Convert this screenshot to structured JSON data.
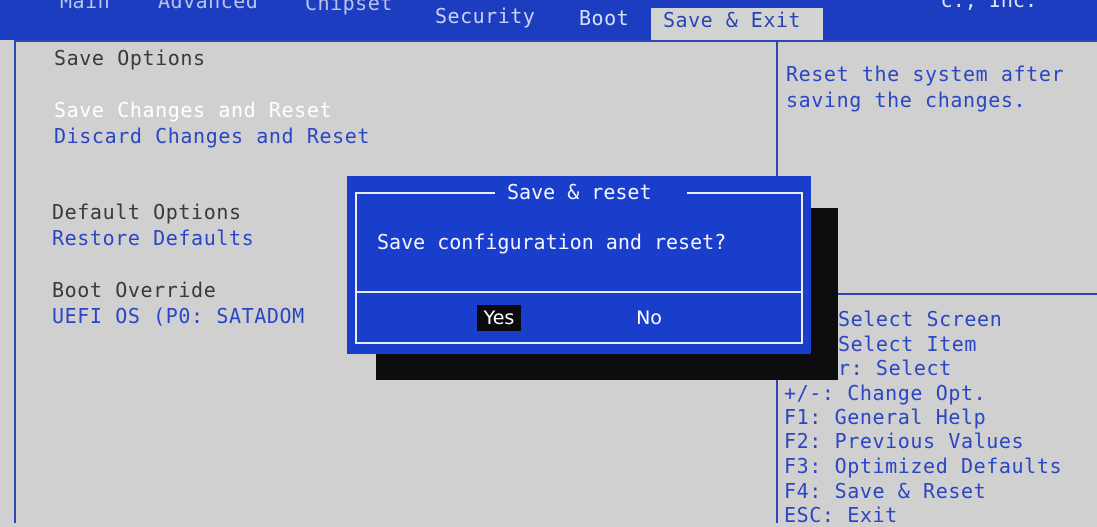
{
  "menu": {
    "tabs": [
      {
        "label": "Main"
      },
      {
        "label": "Advanced"
      },
      {
        "label": "Chipset"
      },
      {
        "label": "Security"
      },
      {
        "label": "Boot"
      },
      {
        "label": "Save & Exit"
      }
    ],
    "active_tab": "Save & Exit",
    "vendor_fragment": "c., Inc."
  },
  "left": {
    "save_header": "Save Options",
    "save_changes_reset": "Save Changes and Reset",
    "discard_changes_reset": "Discard Changes and Reset",
    "default_header": "Default Options",
    "restore_defaults": "Restore Defaults",
    "boot_override_header": "Boot Override",
    "boot_override_item": "UEFI OS (P0: SATADOM"
  },
  "right": {
    "description_line1": "Reset the system after",
    "description_line2": "saving the changes.",
    "help": [
      "Select Screen",
      "Select Item",
      "r: Select",
      "+/-: Change Opt.",
      "F1: General Help",
      "F2: Previous Values",
      "F3: Optimized Defaults",
      "F4: Save & Reset",
      "ESC: Exit"
    ]
  },
  "dialog": {
    "title": "Save & reset",
    "message": "Save configuration and reset?",
    "yes_label": "Yes",
    "no_label": "No"
  },
  "colors": {
    "bios_blue": "#1d3dc0",
    "panel_gray": "#cfd0cf",
    "highlight_text": "#ffffff",
    "option_blue": "#2b46c4"
  }
}
